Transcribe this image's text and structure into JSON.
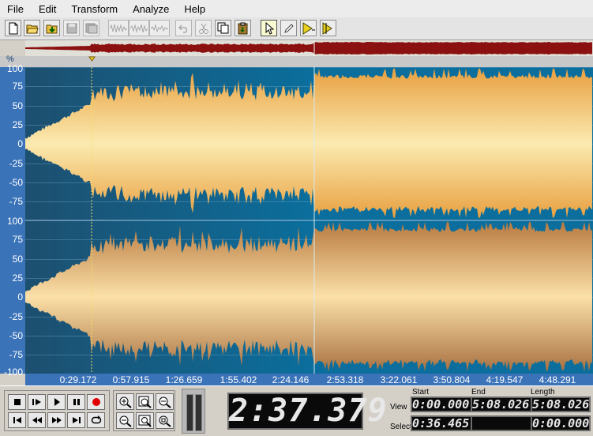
{
  "menu": [
    "File",
    "Edit",
    "Transform",
    "Analyze",
    "Help"
  ],
  "toolbar": {
    "buttons": [
      {
        "icon": "new-file-icon",
        "enabled": true
      },
      {
        "icon": "open-folder-icon",
        "enabled": true
      },
      {
        "icon": "open-download-icon",
        "enabled": true
      },
      {
        "icon": "save-icon",
        "enabled": false
      },
      {
        "icon": "save-all-icon",
        "enabled": false
      },
      {
        "icon": "wave-mix-icon",
        "enabled": false
      },
      {
        "icon": "wave-paste-icon",
        "enabled": false
      },
      {
        "icon": "wave-trim-icon",
        "enabled": false
      },
      {
        "icon": "undo-icon",
        "enabled": false
      },
      {
        "icon": "cut-icon",
        "enabled": false
      },
      {
        "icon": "copy-icon",
        "enabled": true
      },
      {
        "icon": "paste-icon",
        "enabled": true
      },
      {
        "icon": "select-cursor-icon",
        "enabled": true,
        "selected": true
      },
      {
        "icon": "pencil-icon",
        "enabled": true
      },
      {
        "icon": "play-from-cursor-icon",
        "enabled": true
      },
      {
        "icon": "play-to-cursor-icon",
        "enabled": true
      }
    ]
  },
  "waveform": {
    "unit_label": "%",
    "y_labels_top": [
      "100",
      "75",
      "50",
      "25",
      "0",
      "-25",
      "-50",
      "-75"
    ],
    "y_labels_bottom": [
      "100",
      "75",
      "50",
      "25",
      "0",
      "-25",
      "-50",
      "-75",
      "-100"
    ],
    "time_labels": [
      "0:29.172",
      "0:57.915",
      "1:26.659",
      "1:55.402",
      "2:24.146",
      "2:53.318",
      "3:22.061",
      "3:50.804",
      "4:19.547",
      "4:48.291"
    ],
    "playhead_time": "2:37.379",
    "colors": {
      "background": "#0b6e9c",
      "wave_light": "#fbeab0",
      "wave_dark_left": "#1d4f6f",
      "wave_orange": "#e8a040",
      "overview": "#8b1010"
    }
  },
  "transport": {
    "buttons": [
      "stop-icon",
      "pause-play-icon",
      "play-icon",
      "pause-icon",
      "record-icon",
      "skip-start-icon",
      "rewind-icon",
      "fast-forward-icon",
      "skip-end-icon",
      "loop-icon"
    ],
    "zoom_buttons": [
      "zoom-in-h-icon",
      "zoom-fit-icon",
      "zoom-out-h-icon",
      "zoom-out-icon",
      "zoom-full-icon",
      "zoom-selection-icon"
    ],
    "big_time": "2:37.379",
    "headers": {
      "start": "Start",
      "end": "End",
      "length": "Length"
    },
    "rows": {
      "view": {
        "label": "View",
        "start": "0:00.000",
        "end": "5:08.026",
        "length": "5:08.026"
      },
      "select": {
        "label": "Select",
        "start": "0:36.465",
        "end": "",
        "length": "0:00.000"
      }
    }
  }
}
